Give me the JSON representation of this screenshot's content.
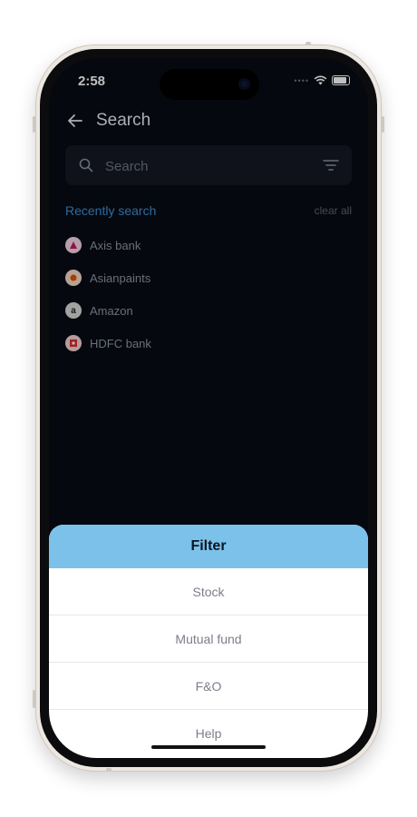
{
  "status_bar": {
    "time": "2:58"
  },
  "header": {
    "title": "Search"
  },
  "search": {
    "placeholder": "Search"
  },
  "recent": {
    "label": "Recently search",
    "clear_label": "clear all",
    "items": [
      {
        "name": "Axis bank",
        "logo_color": "#c2185b",
        "logo_bg": "#f3d5e3"
      },
      {
        "name": "Asianpaints",
        "logo_color": "#e65100",
        "logo_bg": "#f5d9c7"
      },
      {
        "name": "Amazon",
        "logo_glyph": "a",
        "logo_color": "#222222",
        "logo_bg": "#d9d9d9"
      },
      {
        "name": "HDFC bank",
        "logo_color": "#d32f2f",
        "logo_bg": "#f2cfd3"
      }
    ]
  },
  "filter_sheet": {
    "title": "Filter",
    "options": [
      "Stock",
      "Mutual fund",
      "F&O",
      "Help"
    ]
  },
  "colors": {
    "accent": "#3d8fd3",
    "sheet_header": "#7cc1ea",
    "screen_bg": "#080b14"
  }
}
